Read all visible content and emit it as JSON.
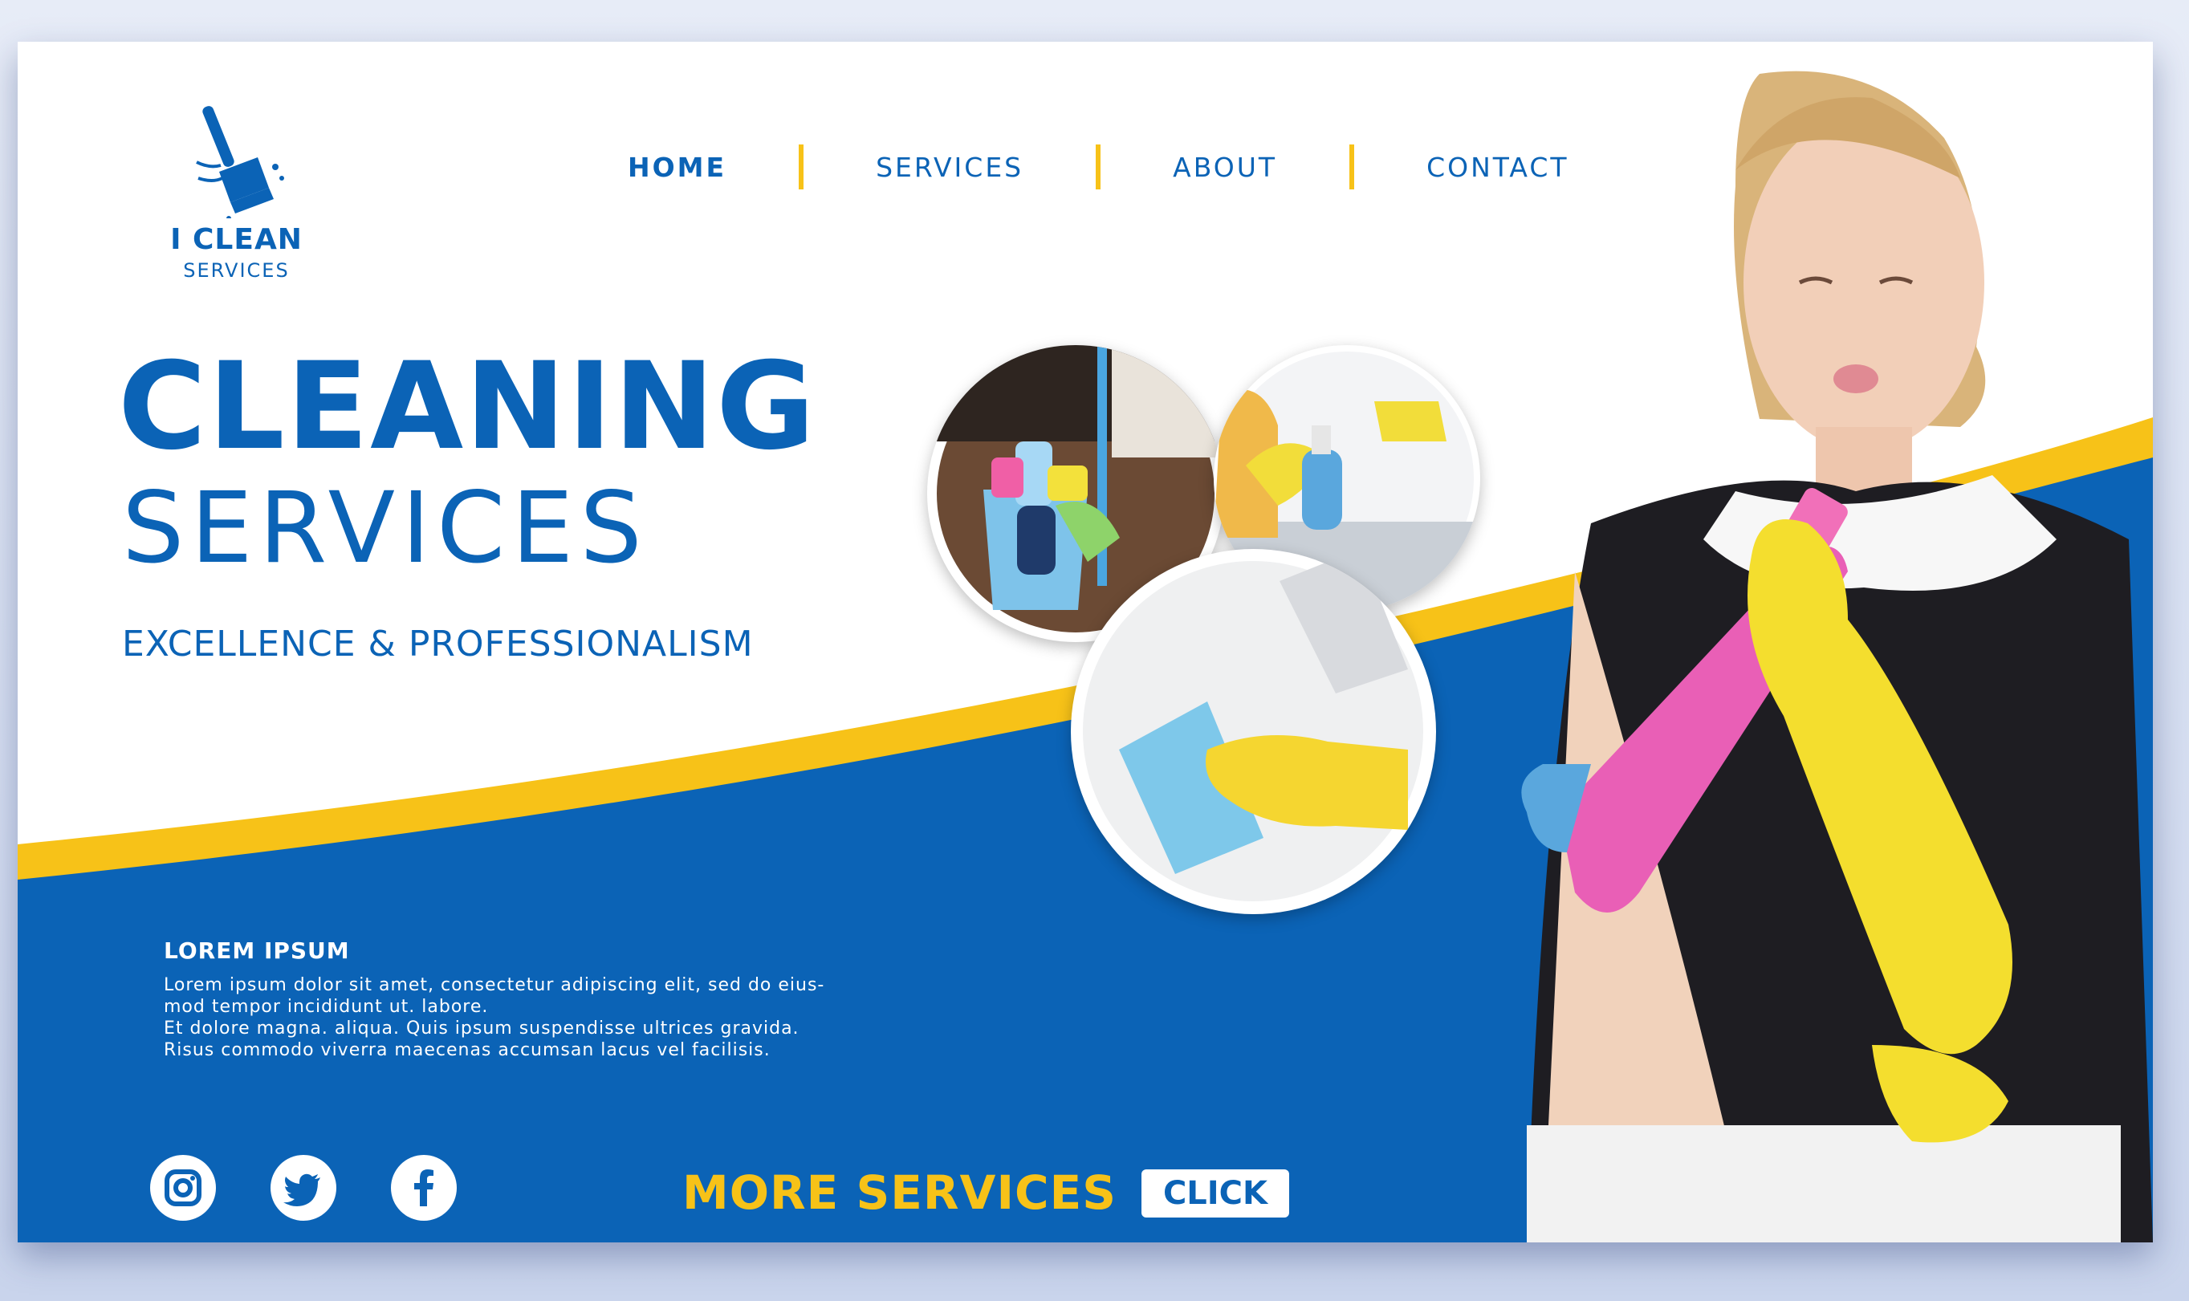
{
  "brand": {
    "name": "I CLEAN",
    "sub": "SERVICES"
  },
  "nav": {
    "items": [
      {
        "label": "HOME",
        "active": true
      },
      {
        "label": "SERVICES",
        "active": false
      },
      {
        "label": "ABOUT",
        "active": false
      },
      {
        "label": "CONTACT",
        "active": false
      }
    ]
  },
  "hero": {
    "title": "CLEANING",
    "subtitle": "SERVICES",
    "tagline": "EXCELLENCE & PROFESSIONALISM"
  },
  "info": {
    "heading": "LOREM IPSUM",
    "lines": [
      "Lorem ipsum dolor sit amet, consectetur adipiscing elit, sed do eius-",
      "mod tempor incididunt ut. labore.",
      "Et dolore magna. aliqua. Quis ipsum suspendisse ultrices gravida.",
      "Risus commodo viverra maecenas accumsan lacus vel facilisis."
    ]
  },
  "social": [
    "instagram-icon",
    "twitter-icon",
    "facebook-icon"
  ],
  "cta": {
    "label": "MORE SERVICES",
    "button": "CLICK"
  },
  "colors": {
    "primary_blue": "#0b63b6",
    "accent_yellow": "#f7c218",
    "white": "#ffffff"
  }
}
